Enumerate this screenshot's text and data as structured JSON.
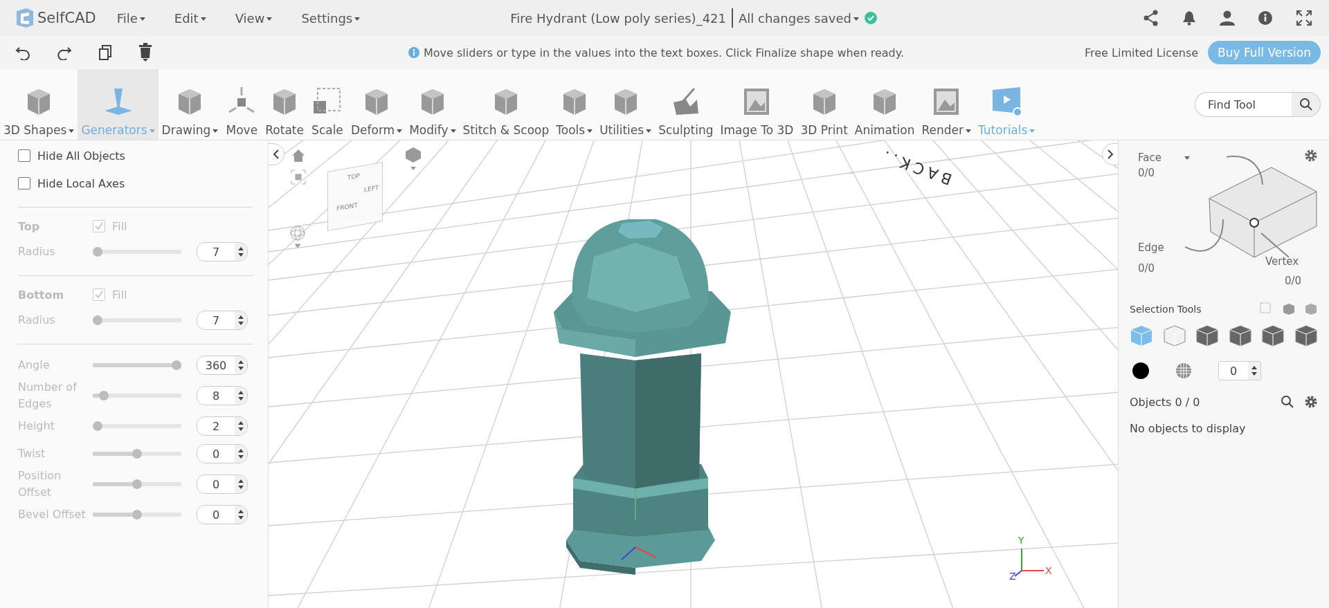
{
  "app": {
    "logo": "SelfCAD",
    "menus": [
      {
        "label": "File"
      },
      {
        "label": "Edit"
      },
      {
        "label": "View"
      },
      {
        "label": "Settings"
      }
    ]
  },
  "document": {
    "title": "Fire Hydrant (Low poly series)_421",
    "save_status": "All changes saved"
  },
  "hint": "Move sliders or type in the values into the text boxes. Click Finalize shape when ready.",
  "license": {
    "text": "Free Limited License",
    "button": "Buy Full Version"
  },
  "toolbar": {
    "tools": [
      {
        "label": "3D Shapes",
        "dropdown": true,
        "selected": false,
        "highlighted": false
      },
      {
        "label": "Generators",
        "dropdown": true,
        "selected": true,
        "highlighted": true
      },
      {
        "label": "Drawing",
        "dropdown": true,
        "selected": false,
        "highlighted": false
      },
      {
        "label": "Move",
        "dropdown": false,
        "selected": false,
        "highlighted": false
      },
      {
        "label": "Rotate",
        "dropdown": false,
        "selected": false,
        "highlighted": false
      },
      {
        "label": "Scale",
        "dropdown": false,
        "selected": false,
        "highlighted": false
      },
      {
        "label": "Deform",
        "dropdown": true,
        "selected": false,
        "highlighted": false
      },
      {
        "label": "Modify",
        "dropdown": true,
        "selected": false,
        "highlighted": false
      },
      {
        "label": "Stitch & Scoop",
        "dropdown": false,
        "selected": false,
        "highlighted": false
      },
      {
        "label": "Tools",
        "dropdown": true,
        "selected": false,
        "highlighted": false
      },
      {
        "label": "Utilities",
        "dropdown": true,
        "selected": false,
        "highlighted": false
      },
      {
        "label": "Sculpting",
        "dropdown": false,
        "selected": false,
        "highlighted": false
      },
      {
        "label": "Image To 3D",
        "dropdown": false,
        "selected": false,
        "highlighted": false
      },
      {
        "label": "3D Print",
        "dropdown": false,
        "selected": false,
        "highlighted": false
      },
      {
        "label": "Animation",
        "dropdown": false,
        "selected": false,
        "highlighted": false
      },
      {
        "label": "Render",
        "dropdown": true,
        "selected": false,
        "highlighted": false
      },
      {
        "label": "Tutorials",
        "dropdown": true,
        "selected": false,
        "highlighted": true
      }
    ],
    "search": {
      "placeholder": "Find Tool"
    }
  },
  "panel": {
    "checkboxes": [
      {
        "label": "Hide All Objects",
        "checked": false
      },
      {
        "label": "Hide Local Axes",
        "checked": false
      }
    ],
    "sections": [
      {
        "title": "Top",
        "fill": {
          "label": "Fill",
          "checked": true
        },
        "sliders": [
          {
            "label": "Radius",
            "level": 0,
            "value": "7"
          }
        ]
      },
      {
        "title": "Bottom",
        "fill": {
          "label": "Fill",
          "checked": true
        },
        "sliders": [
          {
            "label": "Radius",
            "level": 0,
            "value": "7"
          }
        ]
      }
    ],
    "sliders": [
      {
        "label": "Angle",
        "level": 1,
        "value": "360"
      },
      {
        "label": "Number of Edges",
        "level": 0.08,
        "value": "8"
      },
      {
        "label": "Height",
        "level": 0,
        "value": "2"
      },
      {
        "label": "Twist",
        "level": 0.5,
        "value": "0"
      },
      {
        "label": "Position Offset",
        "level": 0.5,
        "value": "0"
      },
      {
        "label": "Bevel Offset",
        "level": 0.5,
        "value": "0"
      }
    ]
  },
  "viewport": {
    "cube_faces": [
      "TOP",
      "FRONT",
      "LEFT"
    ],
    "ground_label": "BACK..",
    "axes": [
      "X",
      "Y",
      "Z"
    ]
  },
  "right_panel": {
    "counts": [
      {
        "label": "Face",
        "count": "0/0"
      },
      {
        "label": "Edge",
        "count": "0/0"
      },
      {
        "label": "Vertex",
        "count": "0/0"
      }
    ],
    "selection_tools": {
      "title": "Selection Tools",
      "modes": [
        {
          "selected": true
        },
        {
          "selected": false
        },
        {
          "selected": false
        },
        {
          "selected": false
        },
        {
          "selected": false
        },
        {
          "selected": false
        }
      ]
    },
    "counter": "0",
    "objects": {
      "title": "Objects 0 / 0",
      "empty": "No objects to display"
    }
  }
}
